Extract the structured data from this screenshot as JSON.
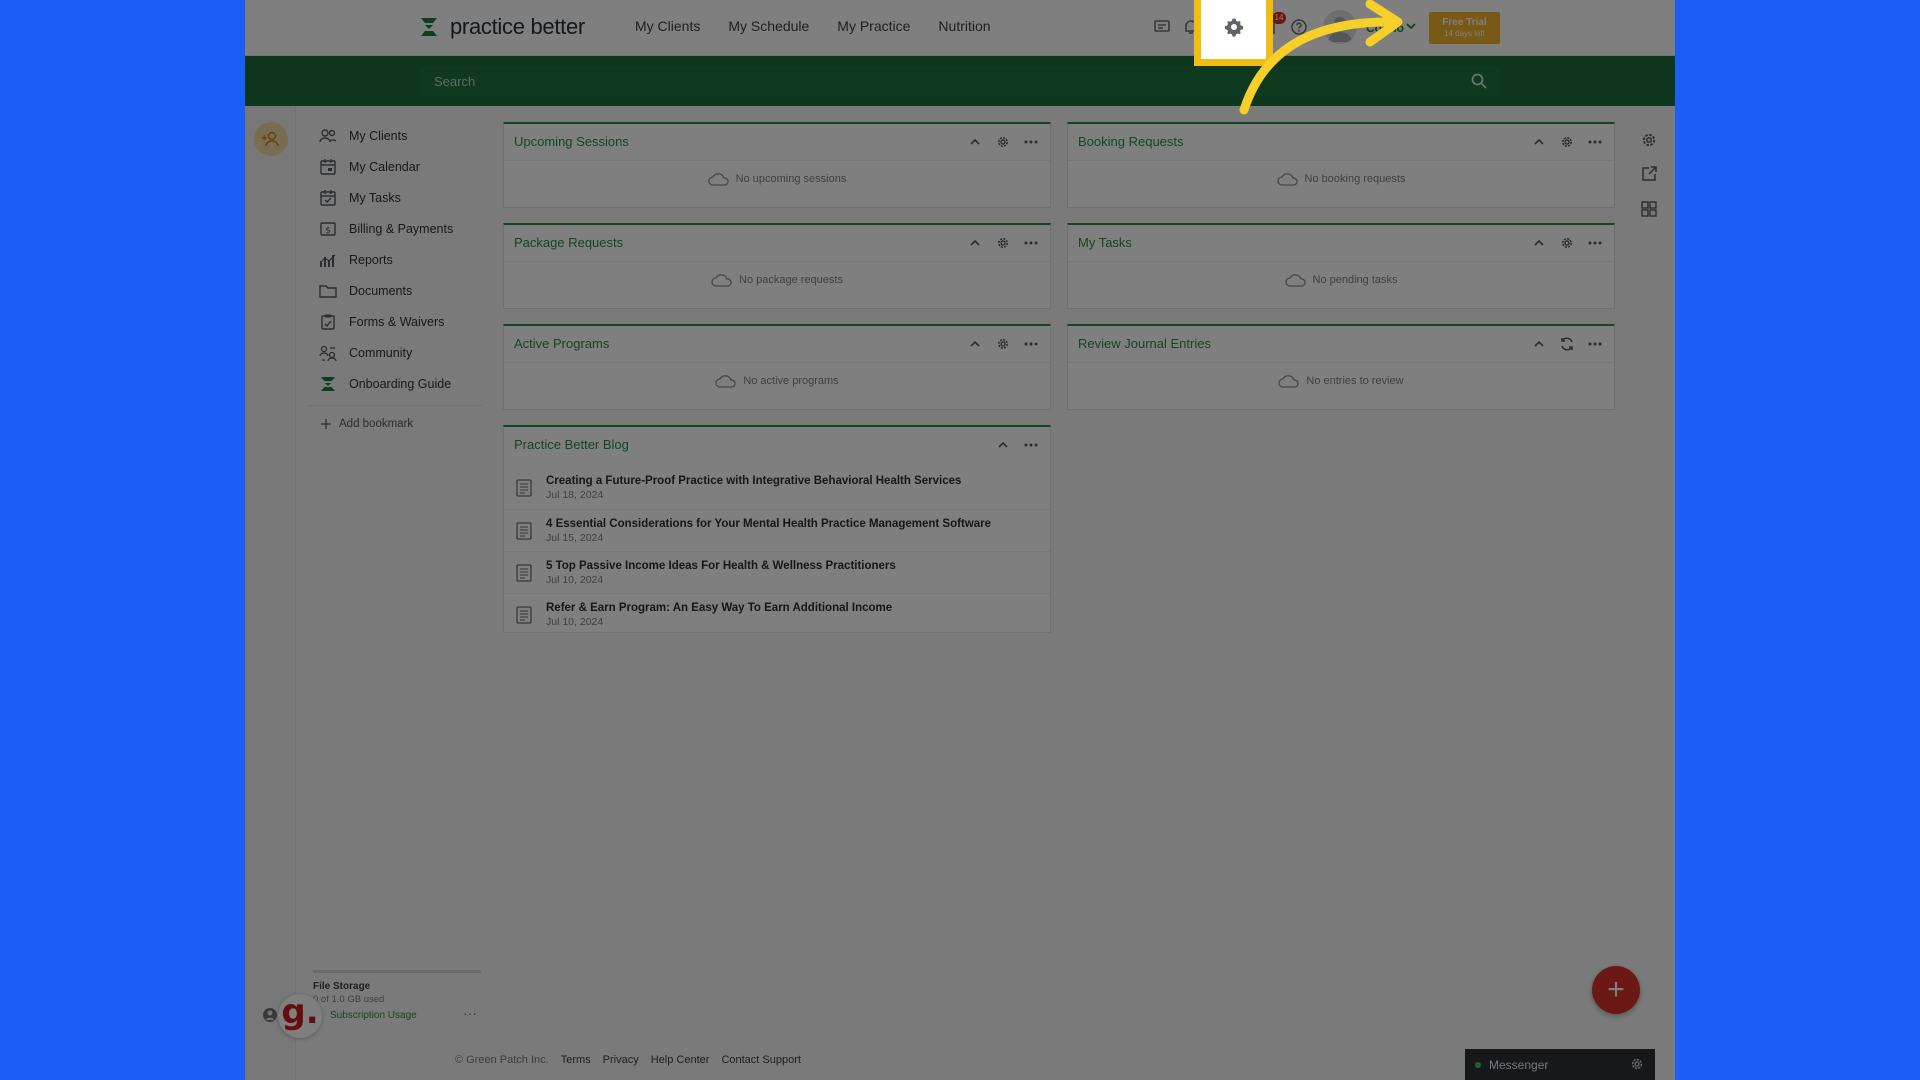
{
  "brand": {
    "name": "practice better",
    "accent": "#2a8a4b",
    "highlight": "#f1bd13"
  },
  "nav": [
    "My Clients",
    "My Schedule",
    "My Practice",
    "Nutrition"
  ],
  "topbar": {
    "notification_count": "14",
    "user_name": "Conno",
    "trial_title": "Free Trial",
    "trial_sub": "14 days left"
  },
  "search": {
    "placeholder": "Search"
  },
  "sidebar": {
    "items": [
      {
        "label": "My Clients",
        "icon": "clients-icon"
      },
      {
        "label": "My Calendar",
        "icon": "calendar-icon"
      },
      {
        "label": "My Tasks",
        "icon": "tasks-icon"
      },
      {
        "label": "Billing & Payments",
        "icon": "billing-icon"
      },
      {
        "label": "Reports",
        "icon": "reports-icon"
      },
      {
        "label": "Documents",
        "icon": "folder-icon"
      },
      {
        "label": "Forms & Waivers",
        "icon": "forms-icon"
      },
      {
        "label": "Community",
        "icon": "community-icon"
      },
      {
        "label": "Onboarding Guide",
        "icon": "onboarding-icon"
      }
    ],
    "add_bookmark": "Add bookmark"
  },
  "panels": {
    "upcoming_sessions": {
      "title": "Upcoming Sessions",
      "empty": "No upcoming sessions"
    },
    "booking_requests": {
      "title": "Booking Requests",
      "empty": "No booking requests"
    },
    "package_requests": {
      "title": "Package Requests",
      "empty": "No package requests"
    },
    "my_tasks": {
      "title": "My Tasks",
      "empty": "No pending tasks"
    },
    "active_programs": {
      "title": "Active Programs",
      "empty": "No active programs"
    },
    "review_journal": {
      "title": "Review Journal Entries",
      "empty": "No entries to review"
    },
    "blog": {
      "title": "Practice Better Blog",
      "posts": [
        {
          "title": "Creating a Future-Proof Practice with Integrative Behavioral Health Services",
          "date": "Jul 18, 2024"
        },
        {
          "title": "4 Essential Considerations for Your Mental Health Practice Management Software",
          "date": "Jul 15, 2024"
        },
        {
          "title": "5 Top Passive Income Ideas For Health & Wellness Practitioners",
          "date": "Jul 10, 2024"
        },
        {
          "title": "Refer & Earn Program: An Easy Way To Earn Additional Income",
          "date": "Jul 10, 2024"
        }
      ]
    }
  },
  "storage": {
    "label": "File Storage",
    "used": "0 of 1.0 GB used",
    "subscription": "Subscription Usage"
  },
  "footer": {
    "copyright": "© Green Patch Inc.",
    "links": [
      "Terms",
      "Privacy",
      "Help Center",
      "Contact Support"
    ]
  },
  "messenger": {
    "label": "Messenger"
  },
  "fab": {
    "label": "+"
  },
  "guide_logo": {
    "letter": "g."
  }
}
